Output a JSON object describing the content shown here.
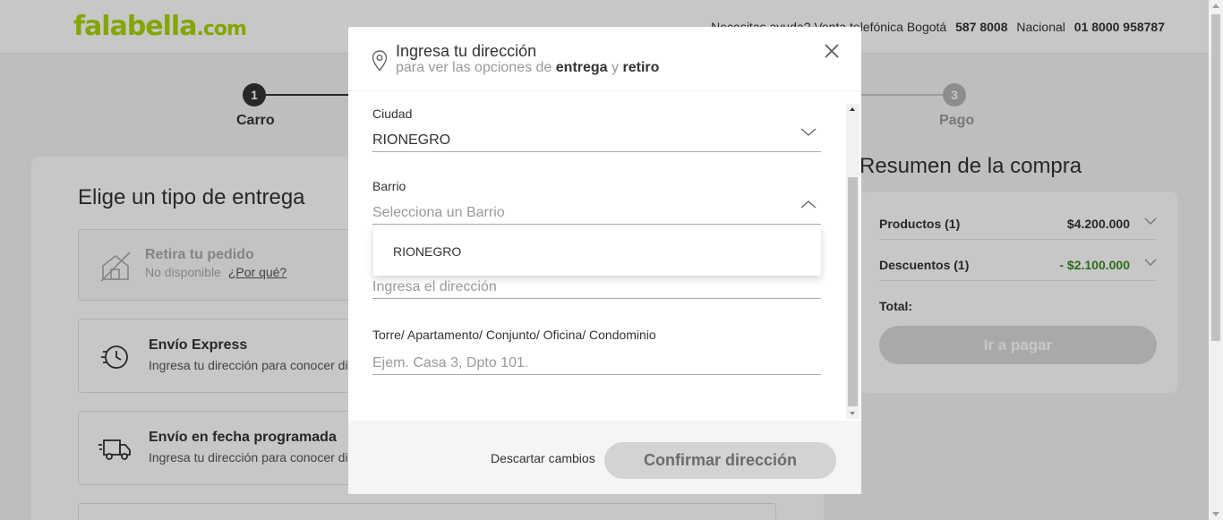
{
  "header": {
    "logo": "falabella",
    "logo_suffix": ".com",
    "contact_text": "Necesitas ayuda? Venta telefónica Bogotá",
    "phone_bogota": "587 8008",
    "national_label": "Nacional",
    "phone_national": "01 8000 958787"
  },
  "steps": {
    "step1_number": "1",
    "step1_label": "Carro",
    "step3_number": "3",
    "step3_label": "Pago"
  },
  "delivery": {
    "title": "Elige un tipo de entrega",
    "options": [
      {
        "title": "Retira tu pedido",
        "subtitle": "No disponible",
        "link": "¿Por qué?"
      },
      {
        "title": "Envío Express",
        "subtitle": "Ingresa tu dirección para conocer dis"
      },
      {
        "title": "Envío en fecha programada",
        "subtitle": "Ingresa tu dirección para conocer dis"
      }
    ]
  },
  "summary": {
    "title": "Resumen de la compra",
    "products_label": "Productos (1)",
    "products_value": "$4.200.000",
    "discounts_label": "Descuentos (1)",
    "discounts_value": "- $2.100.000",
    "total_label": "Total:",
    "pay_button": "Ir a pagar"
  },
  "modal": {
    "title": "Ingresa tu dirección",
    "subtitle_pre": "para ver las opciones de",
    "subtitle_bold1": "entrega",
    "subtitle_mid": "y",
    "subtitle_bold2": "retiro",
    "city_label": "Ciudad",
    "city_value": "RIONEGRO",
    "barrio_label": "Barrio",
    "barrio_placeholder": "Selecciona un Barrio",
    "barrio_options": [
      "RIONEGRO"
    ],
    "address_placeholder": "Ingresa el dirección",
    "extra_label": "Torre/ Apartamento/ Conjunto/ Oficina/ Condominio",
    "extra_placeholder": "Ejem. Casa 3, Dpto 101.",
    "discard_button": "Descartar cambios",
    "confirm_button": "Confirmar dirección"
  },
  "colors": {
    "brand_green": "#aad500",
    "discount_green": "#3b8b25"
  }
}
